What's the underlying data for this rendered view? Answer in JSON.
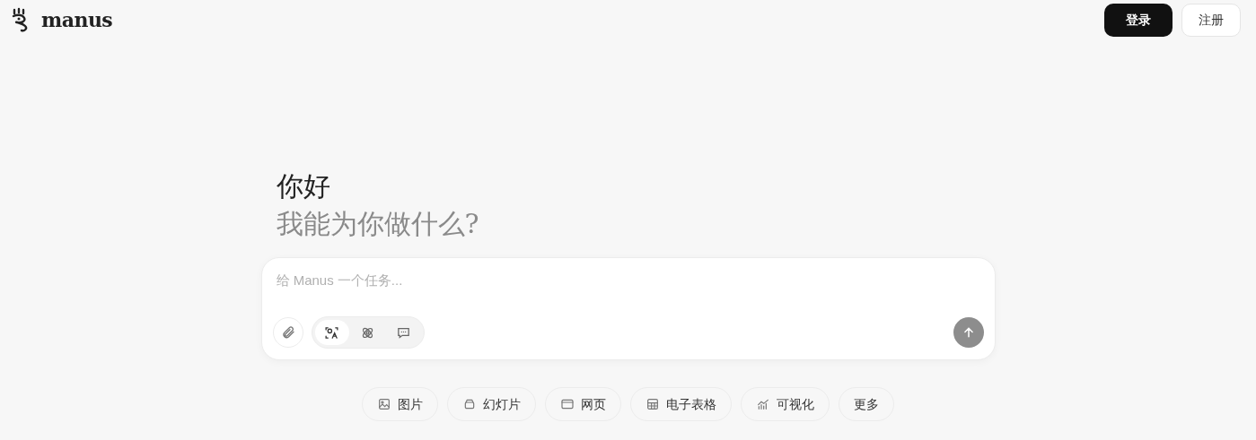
{
  "header": {
    "logo_text": "manus",
    "buttons": [
      {
        "label": "登录",
        "kind": "primary"
      },
      {
        "label": "注册",
        "kind": "secondary"
      }
    ]
  },
  "greeting": {
    "title": "你好",
    "subtitle": "我能为你做什么?"
  },
  "composer": {
    "placeholder": "给 Manus 一个任务...",
    "modes": [
      {
        "kind": "agent",
        "selected": true
      },
      {
        "kind": "atom",
        "selected": false
      },
      {
        "kind": "chat",
        "selected": false
      }
    ]
  },
  "quick_actions": [
    {
      "kind": "image",
      "label": "图片"
    },
    {
      "kind": "slides",
      "label": "幻灯片"
    },
    {
      "kind": "webpage",
      "label": "网页"
    },
    {
      "kind": "sheet",
      "label": "电子表格"
    },
    {
      "kind": "chart",
      "label": "可视化"
    },
    {
      "kind": "more",
      "label": "更多"
    }
  ]
}
